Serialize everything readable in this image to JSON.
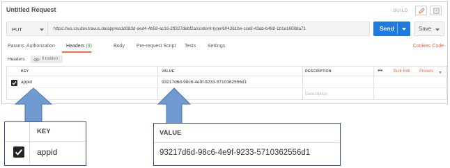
{
  "request": {
    "title": "Untitled Request",
    "build_label": "BUILD",
    "icons": {
      "edit": "pencil-icon",
      "docs": "document-icon"
    }
  },
  "url_bar": {
    "method": "PUT",
    "url": "https://ws.srv.dev.travus.de/app/ea1d083d-aed4-4b58-ac16-2ff327debf2a/content-type/604361be-cce8-43ab-b488-1b1e16088a71",
    "send_label": "Send",
    "save_label": "Save"
  },
  "tabs": {
    "params": "Params",
    "authorization": "Authorization",
    "headers": "Headers",
    "headers_count": "(9)",
    "body": "Body",
    "pre_request": "Pre-request Script",
    "tests": "Tests",
    "settings": "Settings",
    "cookies": "Cookies",
    "code": "Code"
  },
  "subheader": {
    "label": "Headers",
    "hidden_badge": "8 hidden"
  },
  "table": {
    "columns": {
      "key": "KEY",
      "value": "VALUE",
      "description": "DESCRIPTION"
    },
    "more_label": "•••",
    "bulk_edit": "Bulk Edit",
    "presets": "Presets",
    "rows": [
      {
        "checked": true,
        "key": "appid",
        "value": "93217d6d-98c6-4e9f-9233-5710362556d1",
        "description": ""
      }
    ],
    "new_row": {
      "description_placeholder": "Description"
    }
  },
  "zoom": {
    "key_header": "KEY",
    "key_value": "appid",
    "value_header": "VALUE",
    "value_value": "93217d6d-98c6-4e9f-9233-5710362556d1"
  },
  "colors": {
    "accent": "#f26b3a",
    "send_blue": "#1e7ae0",
    "arrow_blue": "#6f9bd1",
    "header_count_green": "#2a9d4a"
  }
}
